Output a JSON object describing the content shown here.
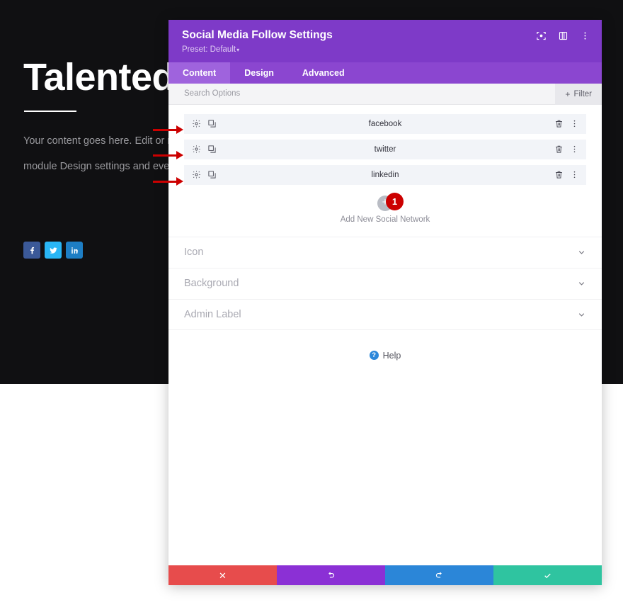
{
  "background_site": {
    "heading": "Talented peo",
    "paragraph_line1": "Your content goes here. Edit or remo",
    "paragraph_line2": "module Design settings and even ap",
    "social_icons": [
      {
        "name": "facebook",
        "glyph": "f",
        "color": "#3b5998"
      },
      {
        "name": "twitter",
        "glyph": "t",
        "color": "#29b6f6"
      },
      {
        "name": "linkedin",
        "glyph": "in",
        "color": "#1d7ec4"
      }
    ]
  },
  "modal": {
    "title": "Social Media Follow Settings",
    "preset": "Preset: Default",
    "preset_caret": "▾",
    "header_icons": [
      {
        "name": "focus-icon"
      },
      {
        "name": "layout-icon"
      },
      {
        "name": "more-vertical-icon"
      }
    ],
    "tabs": [
      {
        "label": "Content",
        "active": true
      },
      {
        "label": "Design",
        "active": false
      },
      {
        "label": "Advanced",
        "active": false
      }
    ],
    "search": {
      "placeholder": "Search Options",
      "value": ""
    },
    "filter_button": {
      "label": "Filter",
      "plus": "+"
    },
    "networks": [
      {
        "label": "facebook"
      },
      {
        "label": "twitter"
      },
      {
        "label": "linkedin"
      }
    ],
    "add_new": {
      "plus": "+",
      "badge": "1",
      "label": "Add New Social Network"
    },
    "accordion": [
      {
        "label": "Icon"
      },
      {
        "label": "Background"
      },
      {
        "label": "Admin Label"
      }
    ],
    "help": {
      "icon_char": "?",
      "label": "Help"
    },
    "footer_buttons": [
      {
        "name": "cancel-button",
        "icon": "close-icon",
        "color": "#e74c4c"
      },
      {
        "name": "undo-button",
        "icon": "undo-icon",
        "color": "#8b30d5"
      },
      {
        "name": "redo-button",
        "icon": "redo-icon",
        "color": "#2b86d8"
      },
      {
        "name": "save-button",
        "icon": "check-icon",
        "color": "#2fc4a0"
      }
    ]
  },
  "annotations": {
    "arrow_color": "#cc0000",
    "count": 3
  },
  "colors": {
    "header_purple": "#7e3ac8",
    "tabbar_purple": "#8b46d0",
    "active_tab_purple": "#9f63dd",
    "row_bg": "#f2f4f8",
    "badge_red": "#cc0000",
    "page_dark": "#101012"
  }
}
